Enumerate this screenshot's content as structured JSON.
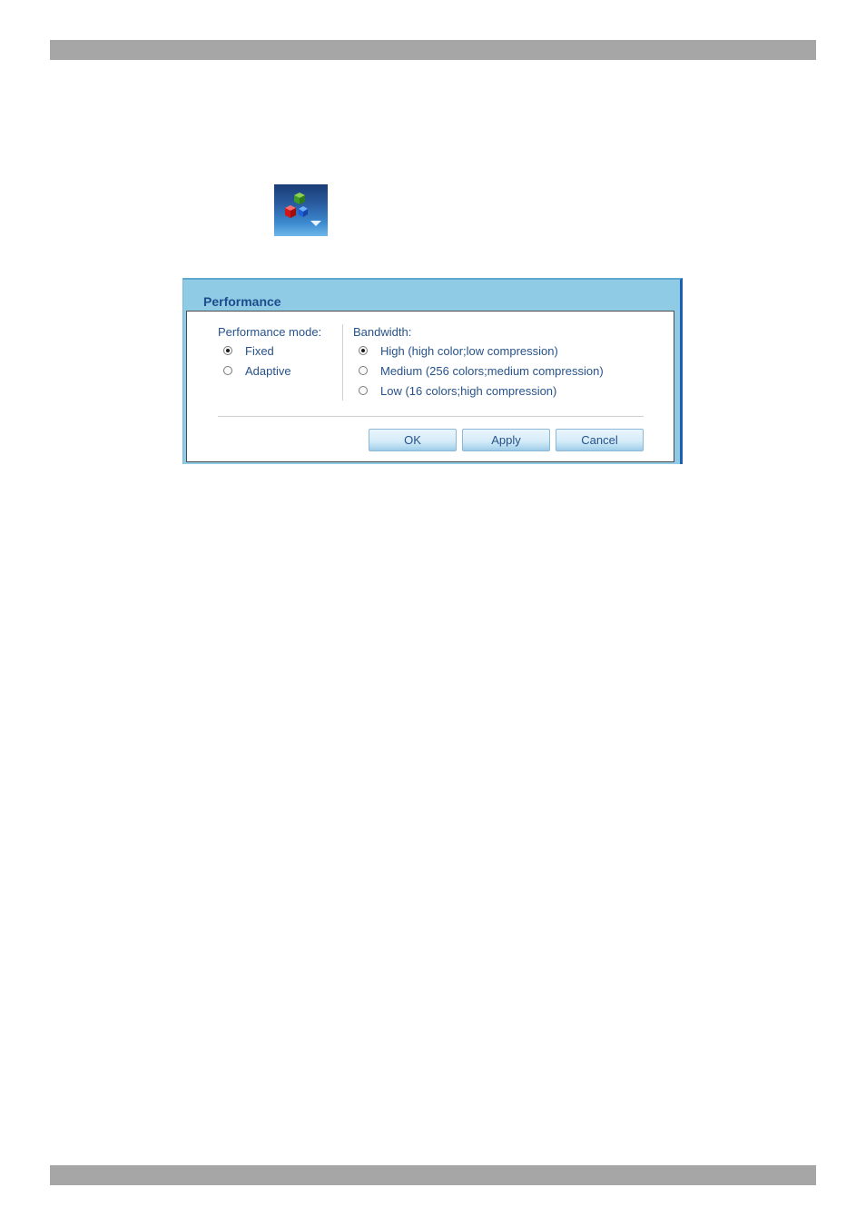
{
  "dialog": {
    "title": "Performance",
    "performance_mode": {
      "label": "Performance mode:",
      "options": [
        {
          "label": "Fixed",
          "checked": true
        },
        {
          "label": "Adaptive",
          "checked": false
        }
      ]
    },
    "bandwidth": {
      "label": "Bandwidth:",
      "options": [
        {
          "label": "High (high color;low compression)",
          "checked": true
        },
        {
          "label": "Medium (256 colors;medium compression)",
          "checked": false
        },
        {
          "label": "Low (16 colors;high compression)",
          "checked": false
        }
      ]
    },
    "buttons": {
      "ok": "OK",
      "apply": "Apply",
      "cancel": "Cancel"
    }
  },
  "colors": {
    "title_text": "#1d4c8c",
    "label_text": "#27528a",
    "titlebar": "#8fcbe5",
    "page_bar": "#a6a6a6"
  },
  "icons": {
    "toolbar_icon": "rgb-cubes-performance-icon"
  }
}
